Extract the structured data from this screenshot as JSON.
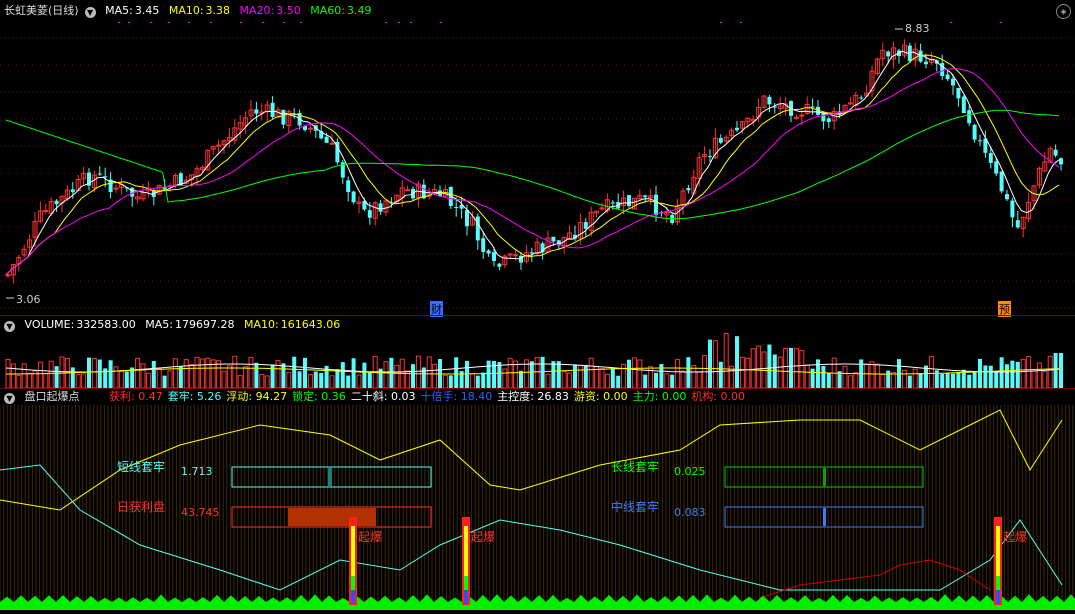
{
  "colors": {
    "up": "#ff3232",
    "down": "#54fcfc",
    "ma5": "#ffffff",
    "ma10": "#ffff00",
    "ma20": "#ff00ff",
    "ma60": "#00ff00",
    "grid": "#7a0000"
  },
  "price_panel": {
    "title": "长虹美菱(日线)",
    "ma5": {
      "label": "MA5:",
      "value": "3.45"
    },
    "ma10": {
      "label": "MA10:",
      "value": "3.38"
    },
    "ma20": {
      "label": "MA20:",
      "value": "3.50"
    },
    "ma60": {
      "label": "MA60:",
      "value": "3.49"
    },
    "high_label": "8.83",
    "low_label": "3.06",
    "marker_cai": "财",
    "marker_yu": "预"
  },
  "volume_panel": {
    "volume": {
      "label": "VOLUME:",
      "value": "332583.00"
    },
    "ma5": {
      "label": "MA5:",
      "value": "179697.28"
    },
    "ma10": {
      "label": "MA10:",
      "value": "161643.06"
    }
  },
  "indicator_panel": {
    "title": "盘口起爆点",
    "stats": [
      {
        "label": "获利:",
        "value": "0.47",
        "color": "#ff3030"
      },
      {
        "label": "套牢:",
        "value": "5.26",
        "color": "#54fcfc"
      },
      {
        "label": "浮动:",
        "value": "94.27",
        "color": "#ffff00"
      },
      {
        "label": "锁定:",
        "value": "0.36",
        "color": "#00ff00"
      },
      {
        "label": "二十斜:",
        "value": "0.03",
        "color": "#ffffff"
      },
      {
        "label": "十倍手:",
        "value": "18.40",
        "color": "#3060ff"
      },
      {
        "label": "主控度:",
        "value": "26.83",
        "color": "#ffffff"
      },
      {
        "label": "游资:",
        "value": "0.00",
        "color": "#ffff00"
      },
      {
        "label": "主力:",
        "value": "0.00",
        "color": "#00ff00"
      },
      {
        "label": "机构:",
        "value": "0.00",
        "color": "#ff3030"
      }
    ],
    "short_trap": {
      "label": "短线套牢",
      "value": "1.713"
    },
    "today_profit": {
      "label": "日获利盘",
      "value": "43.745"
    },
    "long_trap": {
      "label": "长线套牢",
      "value": "0.025"
    },
    "mid_trap": {
      "label": "中线套牢",
      "value": "0.083"
    },
    "burst_label": "起爆",
    "burst_positions": [
      0.325,
      0.43,
      0.925
    ]
  }
}
